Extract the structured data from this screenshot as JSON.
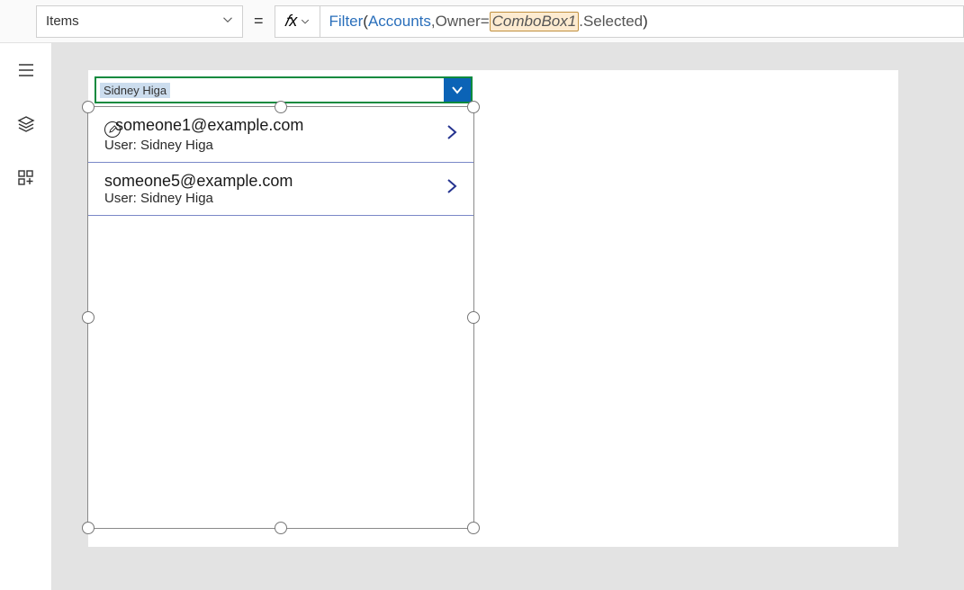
{
  "formula_bar": {
    "property": "Items",
    "equals": "=",
    "fn": "Filter",
    "lp": "(",
    "sp": " ",
    "table": "Accounts",
    "comma": ",",
    "owner": "Owner",
    "eq": "=",
    "box": "ComboBox1",
    "tail": ".Selected",
    "rp": ")"
  },
  "combobox": {
    "chip": "Sidney Higa"
  },
  "rows": [
    {
      "email": "someone1@example.com",
      "subtitle": "User: Sidney Higa",
      "editable": true
    },
    {
      "email": "someone5@example.com",
      "subtitle": "User: Sidney Higa",
      "editable": false
    }
  ]
}
